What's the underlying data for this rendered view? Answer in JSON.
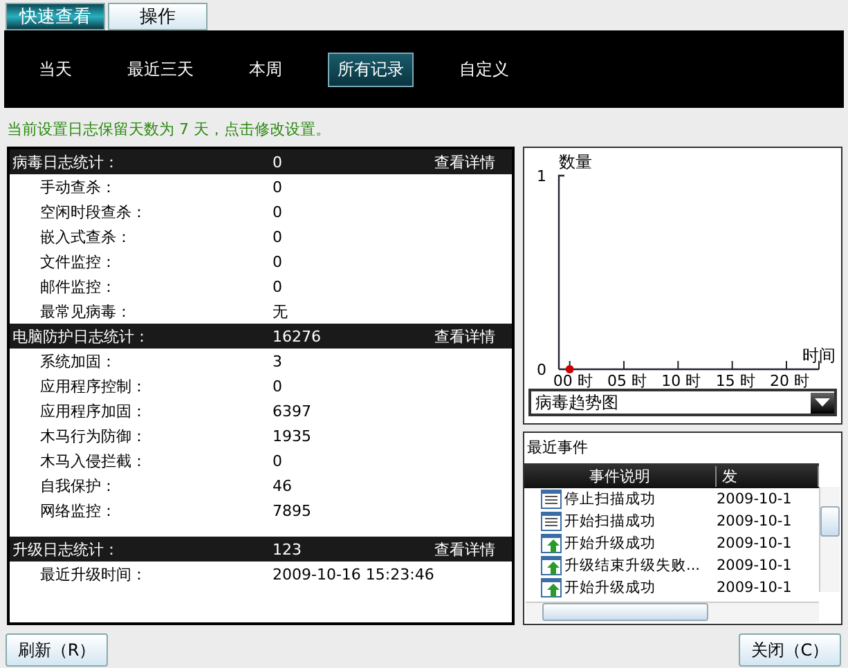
{
  "tabs": [
    {
      "label": "快速查看",
      "selected": true
    },
    {
      "label": "操作",
      "selected": false
    }
  ],
  "ranges": [
    {
      "label": "当天",
      "selected": false
    },
    {
      "label": "最近三天",
      "selected": false
    },
    {
      "label": "本周",
      "selected": false
    },
    {
      "label": "所有记录",
      "selected": true
    },
    {
      "label": "自定义",
      "selected": false
    }
  ],
  "notice": "当前设置日志保留天数为 7 天，点击修改设置。",
  "sections": [
    {
      "title": "病毒日志统计：",
      "value": "0",
      "link": "查看详情",
      "rows": [
        {
          "label": "手动查杀：",
          "value": "0"
        },
        {
          "label": "空闲时段查杀：",
          "value": "0"
        },
        {
          "label": "嵌入式查杀：",
          "value": "0"
        },
        {
          "label": "文件监控：",
          "value": "0"
        },
        {
          "label": "邮件监控：",
          "value": "0"
        },
        {
          "label": "最常见病毒：",
          "value": "无"
        }
      ]
    },
    {
      "title": "电脑防护日志统计：",
      "value": "16276",
      "link": "查看详情",
      "rows": [
        {
          "label": "系统加固：",
          "value": "3"
        },
        {
          "label": "应用程序控制：",
          "value": "0"
        },
        {
          "label": "应用程序加固：",
          "value": "6397"
        },
        {
          "label": "木马行为防御：",
          "value": "1935"
        },
        {
          "label": "木马入侵拦截：",
          "value": "0"
        },
        {
          "label": "自我保护：",
          "value": "46"
        },
        {
          "label": "网络监控：",
          "value": "7895"
        }
      ]
    },
    {
      "title": "升级日志统计：",
      "value": "123",
      "link": "查看详情",
      "rows": [
        {
          "label": "最近升级时间：",
          "value": "2009-10-16 15:23:46"
        }
      ]
    }
  ],
  "trend": {
    "chart_data": {
      "type": "scatter",
      "ylabel": "数量",
      "xlabel": "时间",
      "x": [
        0
      ],
      "series": [
        {
          "color": "#cc0000",
          "values": [
            0
          ]
        }
      ],
      "xlim": [
        -1,
        23
      ],
      "ylim": [
        0,
        1
      ],
      "yticks": [
        0,
        1
      ],
      "xticks": [
        {
          "value": 0,
          "label": "00 时"
        },
        {
          "value": 5,
          "label": "05 时"
        },
        {
          "value": 10,
          "label": "10 时"
        },
        {
          "value": 15,
          "label": "15 时"
        },
        {
          "value": 20,
          "label": "20 时"
        }
      ]
    },
    "select": "病毒趋势图"
  },
  "events": {
    "title": "最近事件",
    "columns": [
      "事件说明",
      "发"
    ],
    "rows": [
      {
        "kind": "list",
        "text": "停止扫描成功",
        "date": "2009-10-1"
      },
      {
        "kind": "list",
        "text": "开始扫描成功",
        "date": "2009-10-1"
      },
      {
        "kind": "upgrade",
        "text": "开始升级成功",
        "date": "2009-10-1"
      },
      {
        "kind": "upgrade",
        "text": "升级结束升级失败...",
        "date": "2009-10-1"
      },
      {
        "kind": "upgrade",
        "text": "开始升级成功",
        "date": "2009-10-1"
      }
    ]
  },
  "buttons": {
    "refresh": "刷新（R）",
    "close": "关闭（C）"
  }
}
